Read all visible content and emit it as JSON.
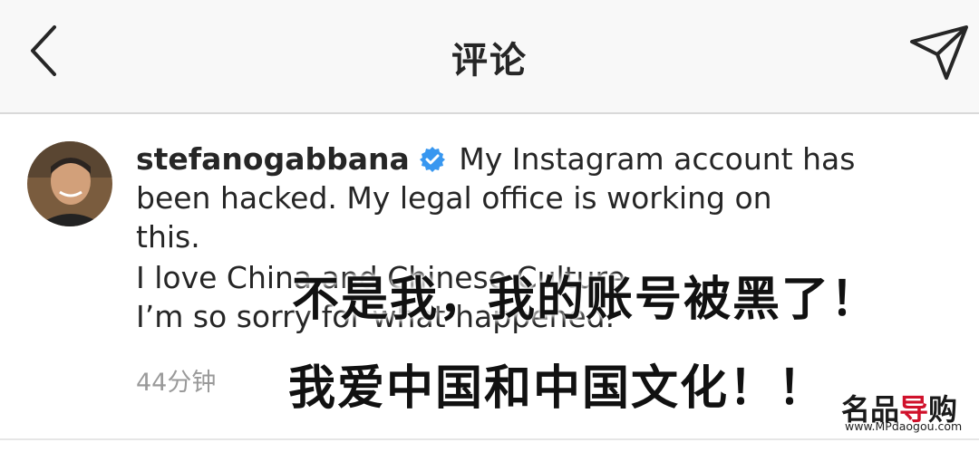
{
  "header": {
    "title": "评论"
  },
  "comment": {
    "username": "stefanogabbana",
    "text_line1": " My Instagram account has",
    "text_line2": "been hacked. My legal office is working on",
    "text_line3": "this.",
    "text_line4": "I love China and Chinese Culture",
    "text_line5": "I’m so sorry for what happened.",
    "timestamp": "44分钟"
  },
  "overlay": {
    "caption_1": "不是我，我的账号被黑了！",
    "caption_2": "我爱中国和中国文化！！"
  },
  "watermark": {
    "brand_a": "名品",
    "brand_b": "导",
    "brand_c": "购",
    "url": "www.MPdaogou.com"
  },
  "colors": {
    "verified": "#3897f0",
    "text": "#262626",
    "timestamp": "#9a9a9a",
    "brand_red": "#d0112b"
  }
}
